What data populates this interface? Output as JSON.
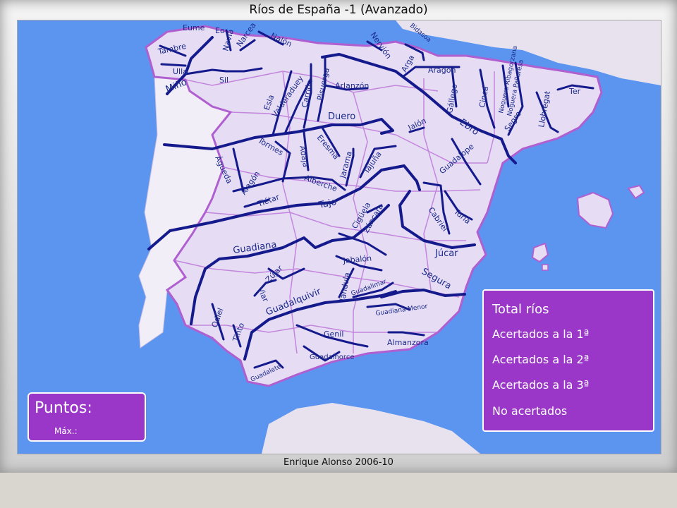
{
  "window": {
    "title": "Ríos de España -1 (Avanzado)",
    "credit": "Enrique Alonso 2006-10"
  },
  "score": {
    "label": "Puntos:",
    "max_label": "Máx.:"
  },
  "totals": {
    "title": "Total ríos",
    "first": "Acertados a la 1ª",
    "second": "Acertados a la 2ª",
    "third": "Acertados a la 3ª",
    "missed": "No acertados"
  },
  "colors": {
    "sea": "#5b95f0",
    "spain": "#e6dcf4",
    "border": "#b05fd0",
    "portugal": "#f2eef8",
    "river": "#141a8c",
    "panel": "#9a36c8"
  },
  "rivers": {
    "eume": "Eume",
    "eo": "Eo",
    "navia": "Navia",
    "narcea": "Narcea",
    "nalon": "Nalón",
    "tambre": "Tambre",
    "ulla": "Ulla",
    "mino": "Miño",
    "sil": "Sil",
    "esla": "Esla",
    "valderaduey": "Valderaduey",
    "carrion": "Carrión",
    "pisuerga": "Pisuerga",
    "arlanzon": "Arlanzón",
    "duero": "Duero",
    "nervion": "Nervión",
    "bidasoa": "Bidasoa",
    "arga": "Arga",
    "aragon": "Aragón",
    "gallego": "Gállego",
    "cinca": "Cinca",
    "noguera_ribagorzana": "Noguera Ribagorzana",
    "noguera_pallaresa": "Noguera Pallaresa",
    "segre": "Segre",
    "llobregat": "Llobregat",
    "ter": "Ter",
    "ebro": "Ebro",
    "jalon": "Jalón",
    "tormes": "Tormes",
    "adaja": "Adaja",
    "eresma": "Eresma",
    "jarama": "Jarama",
    "tajuna": "Tajuña",
    "guadalope": "Guadalope",
    "agueda": "Águeda",
    "alagon": "Alagón",
    "tietar": "Tiétar",
    "alberche": "Alberche",
    "tajo": "Tajo",
    "ciguela": "Cigüela",
    "zancara": "Záncara",
    "cabriel": "Cabriel",
    "turia": "Turia",
    "jucar": "Júcar",
    "guadiana": "Guadiana",
    "jabalon": "Jabalón",
    "zujar": "Zújar",
    "viar": "Viar",
    "jandula": "Jándula",
    "guadalimar": "Guadalimar",
    "segura": "Segura",
    "guadalquivir": "Guadalquivir",
    "guadiana_menor": "Guadiana Menor",
    "odiel": "Odiel",
    "tinto": "Tinto",
    "genil": "Genil",
    "almanzora": "Almanzora",
    "guadalhorce": "Guadalhorce",
    "guadalete": "Guadalete"
  }
}
